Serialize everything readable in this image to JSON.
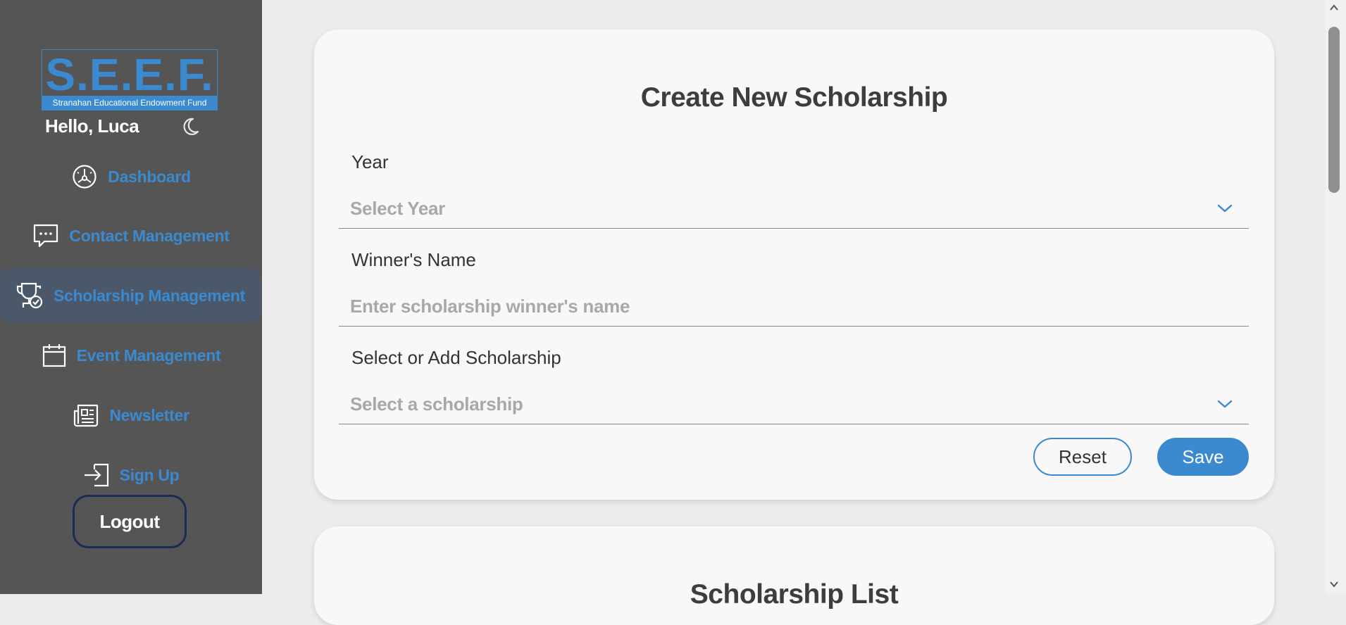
{
  "sidebar": {
    "logo": {
      "main": "S.E.E.F.",
      "sub": "Stranahan Educational Endowment Fund"
    },
    "greeting": "Hello, Luca",
    "items": [
      {
        "label": "Dashboard",
        "icon": "dashboard-gauge-icon"
      },
      {
        "label": "Contact Management",
        "icon": "chat-bubble-icon"
      },
      {
        "label": "Scholarship Management",
        "icon": "trophy-check-icon",
        "active": true
      },
      {
        "label": "Event Management",
        "icon": "calendar-icon"
      },
      {
        "label": "Newsletter",
        "icon": "newspaper-icon"
      },
      {
        "label": "Sign Up",
        "icon": "sign-in-icon"
      }
    ],
    "logout_label": "Logout"
  },
  "form": {
    "title": "Create New Scholarship",
    "year": {
      "label": "Year",
      "placeholder": "Select Year"
    },
    "winner": {
      "label": "Winner's Name",
      "placeholder": "Enter scholarship winner's name"
    },
    "scholarship": {
      "label": "Select or Add Scholarship",
      "placeholder": "Select a scholarship"
    },
    "reset_label": "Reset",
    "save_label": "Save"
  },
  "list": {
    "title": "Scholarship List"
  },
  "colors": {
    "accent": "#3b8ad0",
    "sidebar_bg": "#555555",
    "active_item_bg": "#4a5869",
    "logout_border": "#1a2b54",
    "page_bg": "#ececec",
    "card_bg": "#f8f8f8"
  }
}
